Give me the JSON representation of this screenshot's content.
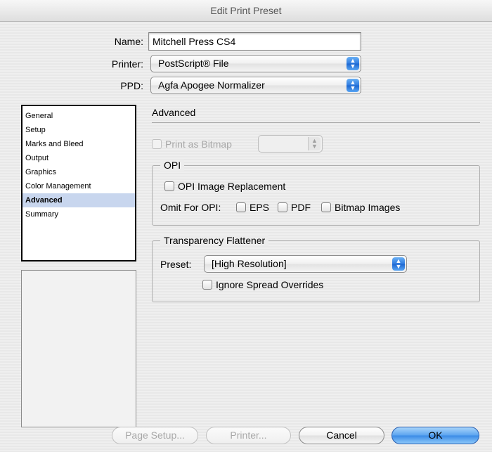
{
  "window": {
    "title": "Edit Print Preset"
  },
  "fields": {
    "name_label": "Name:",
    "name_value": "Mitchell Press CS4",
    "printer_label": "Printer:",
    "printer_value": "PostScript® File",
    "ppd_label": "PPD:",
    "ppd_value": "Agfa Apogee Normalizer"
  },
  "sidebar": {
    "items": [
      {
        "label": "General"
      },
      {
        "label": "Setup"
      },
      {
        "label": "Marks and Bleed"
      },
      {
        "label": "Output"
      },
      {
        "label": "Graphics"
      },
      {
        "label": "Color Management"
      },
      {
        "label": "Advanced",
        "selected": true
      },
      {
        "label": "Summary"
      }
    ]
  },
  "advanced": {
    "title": "Advanced",
    "print_as_bitmap": {
      "label": "Print as Bitmap",
      "checked": false,
      "enabled": false
    },
    "bitmap_resolution_value": "",
    "opi": {
      "legend": "OPI",
      "image_replacement": {
        "label": "OPI Image Replacement",
        "checked": false
      },
      "omit_label": "Omit For OPI:",
      "omit_eps": {
        "label": "EPS",
        "checked": false
      },
      "omit_pdf": {
        "label": "PDF",
        "checked": false
      },
      "omit_bitmap": {
        "label": "Bitmap Images",
        "checked": false
      }
    },
    "flattener": {
      "legend": "Transparency Flattener",
      "preset_label": "Preset:",
      "preset_value": "[High Resolution]",
      "ignore_spread": {
        "label": "Ignore Spread Overrides",
        "checked": false
      }
    }
  },
  "buttons": {
    "page_setup": "Page Setup...",
    "printer": "Printer...",
    "cancel": "Cancel",
    "ok": "OK"
  },
  "icons": {
    "popup_arrows": "⌃⌄"
  },
  "colors": {
    "accent": "#3a8ae6",
    "selection": "#c8d6ee"
  }
}
